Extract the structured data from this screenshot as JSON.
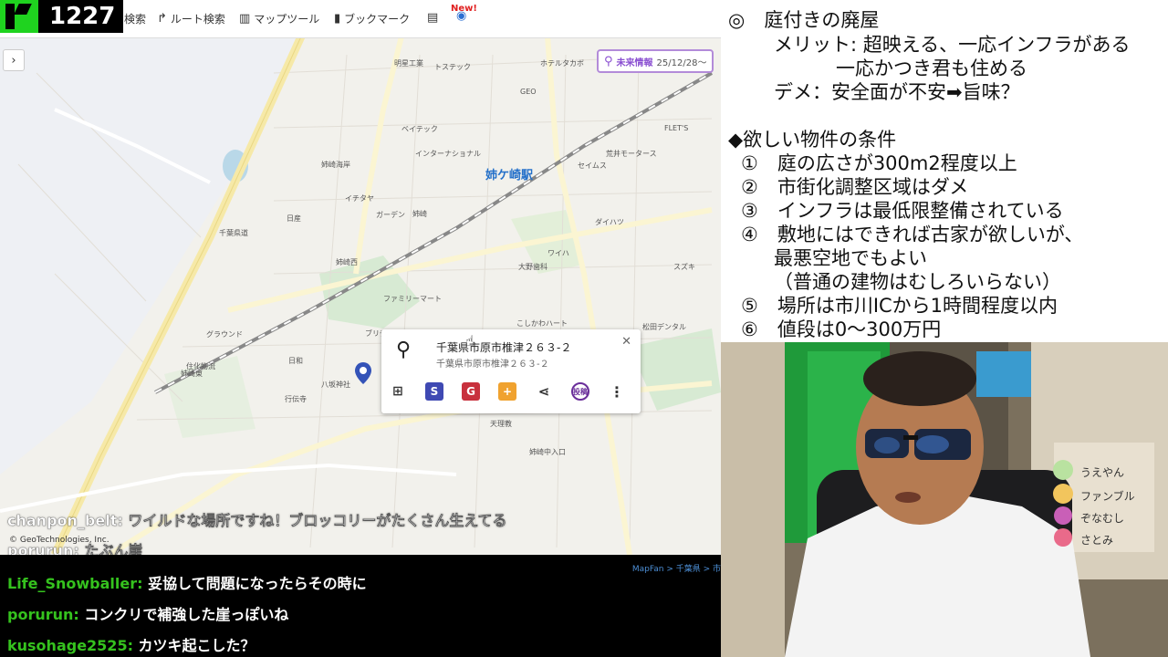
{
  "stream": {
    "viewer_count": "1227"
  },
  "toolbar": {
    "search_label": "検索",
    "route_label": "ルート検索",
    "maptools_label": "マップツール",
    "bookmark_label": "ブックマーク",
    "new_label": "New!"
  },
  "future_info": {
    "label": "未来情報",
    "date": "25/12/28～"
  },
  "map": {
    "station_name": "姉ケ崎駅",
    "labels": [
      "明星工業",
      "トステック",
      "ホテルタカボ",
      "GEO",
      "ベイテック",
      "インターナショナル",
      "姉崎海岸",
      "日産",
      "イチタヤ",
      "姉崎西",
      "ガーデン",
      "ワイハ",
      "グラウンド",
      "姉崎",
      "八坂神社",
      "行伝寺",
      "日和",
      "姉崎東",
      "ブリヂストン",
      "ダイハツ",
      "スズキ",
      "大野歯科",
      "こしかわハート",
      "松田デンタル",
      "天理教",
      "姉崎中入口",
      "ファミリーマート",
      "千葉県道",
      "住化物流",
      "荒井モータース",
      "セイムス",
      "FLET'S"
    ],
    "copyright": "© GeoTechnologies, Inc.",
    "breadcrumb": "MapFan > 千葉県 > 市"
  },
  "popup": {
    "address_main": "千葉県市原市椎津２６３-２",
    "address_sub": "千葉県市原市椎津２６３-２",
    "s_label": "S",
    "g_label": "G",
    "post_label": "投稿"
  },
  "overlay_chat": [
    {
      "user": "chanpon_belt:",
      "msg": "ワイルドな場所ですね！ブロッコリーがたくさん生えてる"
    },
    {
      "user": "porurun:",
      "msg": "たぶん崖"
    }
  ],
  "chat": [
    {
      "user": "Life_Snowballer:",
      "msg": "妥協して問題になったらその時に"
    },
    {
      "user": "porurun:",
      "msg": "コンクリで補強した崖っぽいね"
    },
    {
      "user": "kusohage2525:",
      "msg": "カツキ起こした？"
    }
  ],
  "notes": {
    "heading": "◎　庭付きの廃屋",
    "merit_1": "メリット: 超映える、一応インフラがある",
    "merit_2": "一応かつき君も住める",
    "demerit": "デメ：安全面が不安➡旨味？",
    "conditions_title": "◆欲しい物件の条件",
    "items": [
      "①　庭の広さが300m2程度以上",
      "②　市街化調整区域はダメ",
      "③　インフラは最低限整備されている",
      "④　敷地にはできれば古家が欲しいが、",
      "最悪空地でもよい",
      "（普通の建物はむしろいらない）",
      "⑤　場所は市川ICから1時間程度以内",
      "⑥　値段は0～300万円"
    ]
  },
  "cam": {
    "names": [
      "うえやん",
      "ファンブル",
      "ぞなむし",
      "さとみ"
    ]
  }
}
